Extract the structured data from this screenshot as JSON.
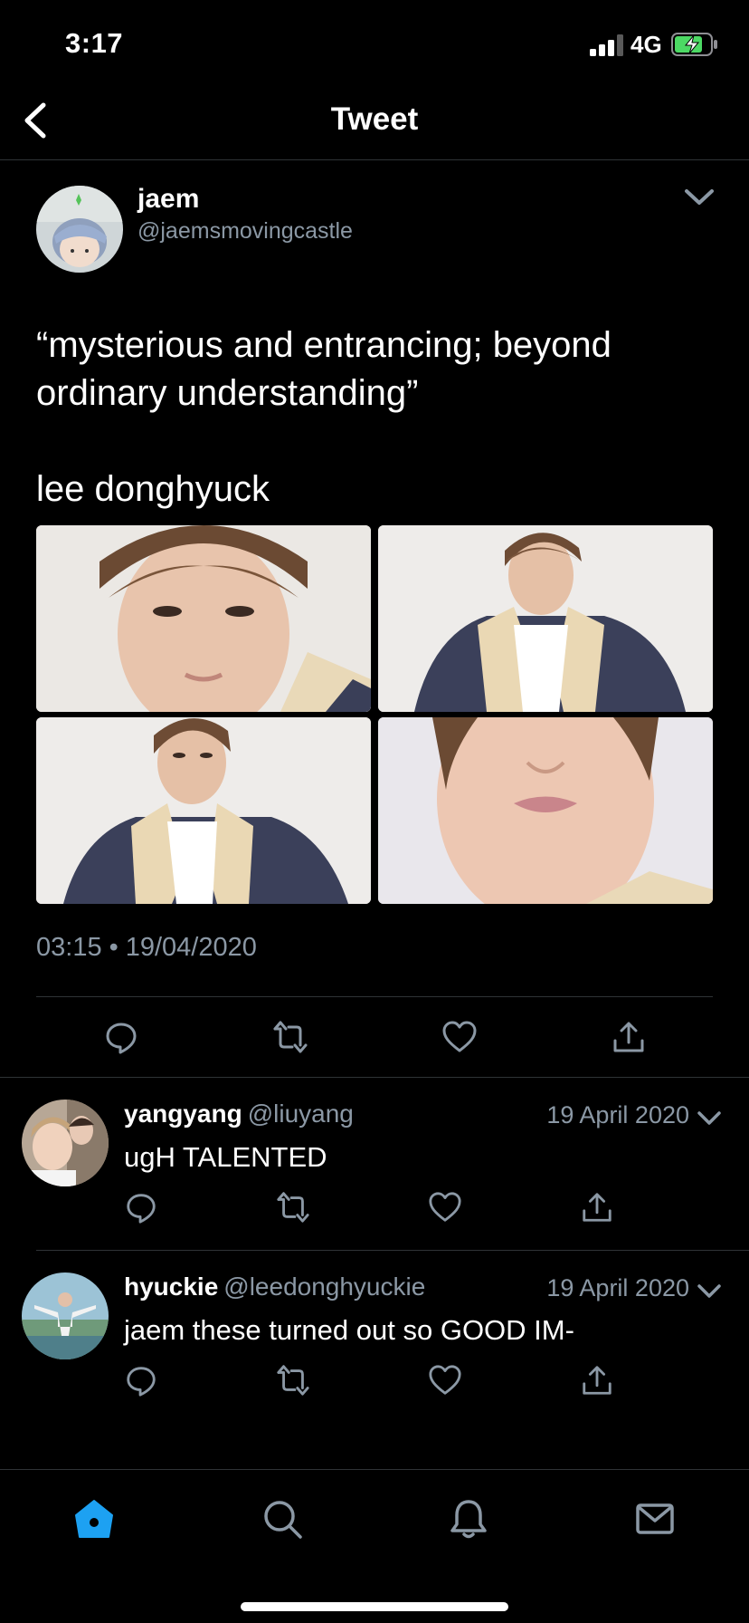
{
  "status_bar": {
    "time": "3:17",
    "network": "4G",
    "signal_icon": "signal-bars-icon",
    "battery_icon": "battery-charging-icon"
  },
  "header": {
    "title": "Tweet",
    "back_icon": "chevron-left-icon"
  },
  "tweet": {
    "author_name": "jaem",
    "author_handle": "@jaemsmovingcastle",
    "text": "“mysterious and entrancing; beyond ordinary understanding”\n\nlee donghyuck",
    "time": "03:15",
    "separator": "•",
    "date": "19/04/2020",
    "photos": [
      "close-up portrait",
      "portrait looking aside",
      "portrait in jacket",
      "close-up face crop"
    ]
  },
  "replies": [
    {
      "name": "yangyang",
      "handle": "@liuyang",
      "date": "19 April 2020",
      "text": "ugH TALENTED"
    },
    {
      "name": "hyuckie",
      "handle": "@leedonghyuckie",
      "date": "19 April 2020",
      "text": "jaem these turned out so GOOD IM-"
    }
  ],
  "tab_bar": {
    "items": [
      "home-icon",
      "search-icon",
      "notifications-icon",
      "messages-icon"
    ],
    "active": "home-icon"
  },
  "colors": {
    "background": "#000000",
    "secondary_text": "#8b98a5",
    "divider": "#2f3336",
    "accent": "#1da1f2",
    "battery_green": "#4cd964"
  }
}
